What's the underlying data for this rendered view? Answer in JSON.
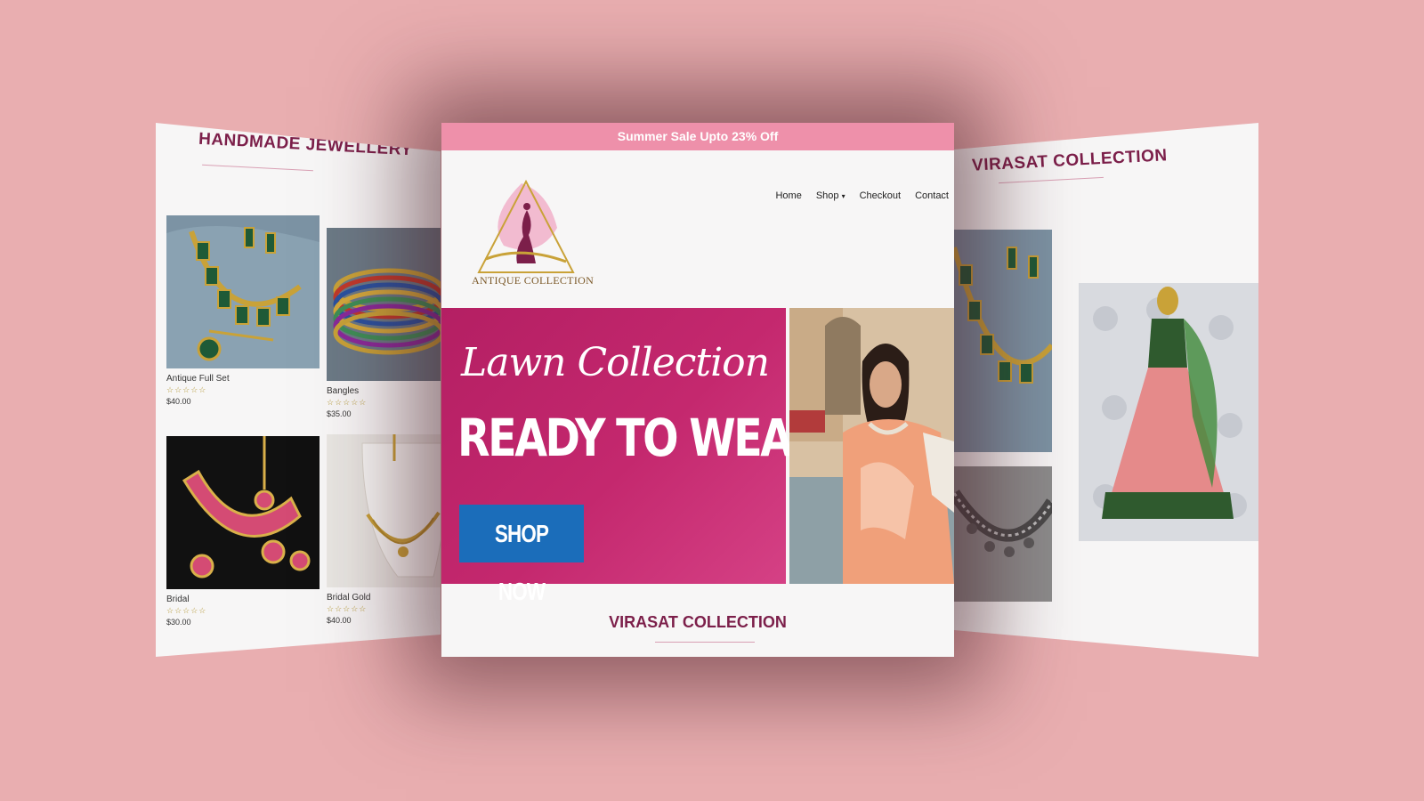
{
  "colors": {
    "background": "#e9aeb0",
    "accent_pink": "#ee90aa",
    "hero_magenta": "#b41f63",
    "heading_plum": "#7c1f4a",
    "button_blue": "#1b6dba"
  },
  "left_panel": {
    "title": "HANDMADE JEWELLERY",
    "products": [
      {
        "name": "Antique Full Set",
        "rating": "☆☆☆☆☆",
        "price": "$40.00"
      },
      {
        "name": "Bangles",
        "rating": "☆☆☆☆☆",
        "price": "$35.00"
      },
      {
        "name": "Bridal",
        "rating": "☆☆☆☆☆",
        "price": "$30.00"
      },
      {
        "name": "Bridal Gold",
        "rating": "☆☆☆☆☆",
        "price": "$40.00"
      }
    ]
  },
  "main": {
    "promo": "Summer Sale Upto 23% Off",
    "logo_text": "ANTIQUE COLLECTION",
    "nav": [
      "Home",
      "Shop",
      "Checkout",
      "Contact"
    ],
    "nav_icon": "chevron-down-icon",
    "hero": {
      "script": "Lawn Collection",
      "title": "READY TO WEAR",
      "button": "SHOP NOW"
    },
    "section_title": "VIRASAT COLLECTION"
  },
  "right_panel": {
    "title": "VIRASAT COLLECTION"
  }
}
